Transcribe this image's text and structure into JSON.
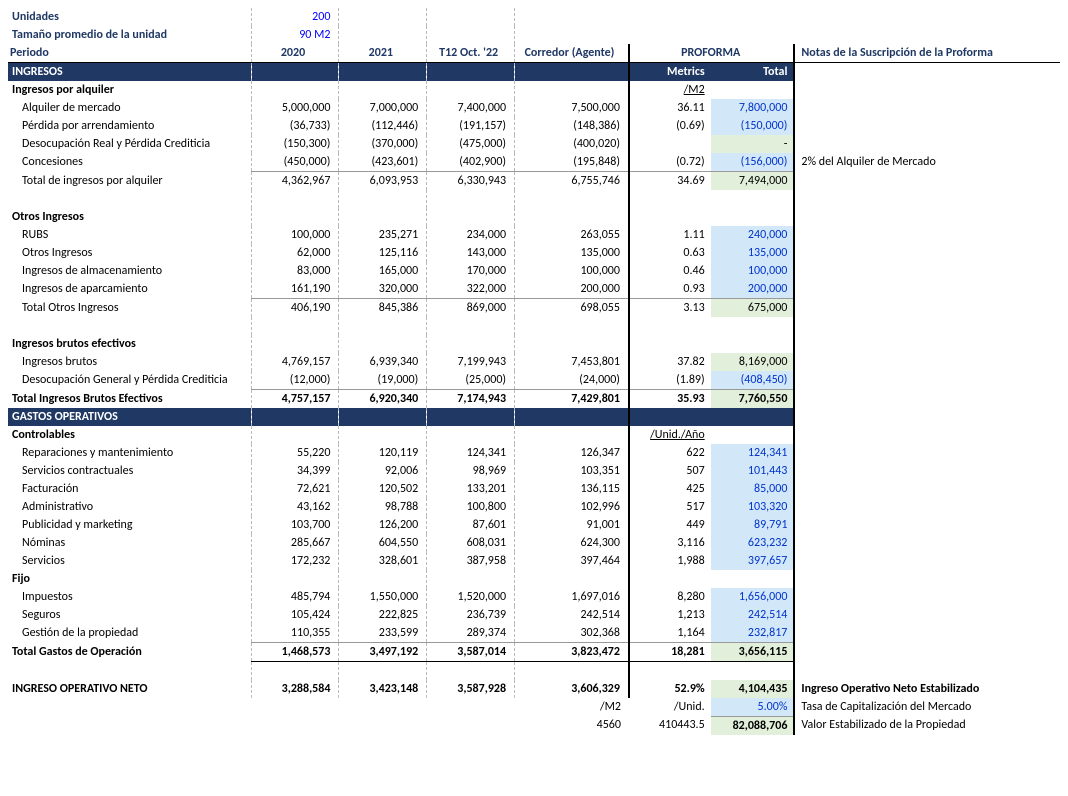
{
  "top": {
    "units_label": "Unidades",
    "units_value": "200",
    "size_label": "Tamaño promedio de la unidad",
    "size_value": "90 M2"
  },
  "cols": {
    "period": "Periodo",
    "y2020": "2020",
    "y2021": "2021",
    "t12": "T12 Oct. '22",
    "broker": "Corredor (Agente)",
    "proforma": "PROFORMA",
    "metrics": "Metrics",
    "total": "Total",
    "notes": "Notas de la Suscripción de la Proforma"
  },
  "sect": {
    "ingresos": "INGRESOS",
    "rental": "Ingresos por alquiler",
    "other": "Otros Ingresos",
    "egi_sec": "Ingresos brutos efectivos",
    "opex": "GASTOS OPERATIVOS",
    "control": "Controlables",
    "fijo": "Fijo",
    "m2": "/M2",
    "unityr": "/Unid./Año"
  },
  "rows": {
    "mkt_rent": {
      "l": "Alquiler de mercado",
      "a": "5,000,000",
      "b": "7,000,000",
      "c": "7,400,000",
      "d": "7,500,000",
      "m": "36.11",
      "t": "7,800,000"
    },
    "loss_lease": {
      "l": "Pérdida por arrendamiento",
      "a": "(36,733)",
      "b": "(112,446)",
      "c": "(191,157)",
      "d": "(148,386)",
      "m": "(0.69)",
      "t": "(150,000)"
    },
    "vac_credit": {
      "l": "Desocupación Real y Pérdida Crediticia",
      "a": "(150,300)",
      "b": "(370,000)",
      "c": "(475,000)",
      "d": "(400,020)",
      "m": "",
      "t": "-"
    },
    "concess": {
      "l": "Concesiones",
      "a": "(450,000)",
      "b": "(423,601)",
      "c": "(402,900)",
      "d": "(195,848)",
      "m": "(0.72)",
      "t": "(156,000)",
      "note": "2% del Alquiler de Mercado"
    },
    "rent_total": {
      "l": "Total de ingresos por alquiler",
      "a": "4,362,967",
      "b": "6,093,953",
      "c": "6,330,943",
      "d": "6,755,746",
      "m": "34.69",
      "t": "7,494,000"
    },
    "rubs": {
      "l": "RUBS",
      "a": "100,000",
      "b": "235,271",
      "c": "234,000",
      "d": "263,055",
      "m": "1.11",
      "t": "240,000"
    },
    "other_i": {
      "l": "Otros Ingresos",
      "a": "62,000",
      "b": "125,116",
      "c": "143,000",
      "d": "135,000",
      "m": "0.63",
      "t": "135,000"
    },
    "storage": {
      "l": "Ingresos de almacenamiento",
      "a": "83,000",
      "b": "165,000",
      "c": "170,000",
      "d": "100,000",
      "m": "0.46",
      "t": "100,000"
    },
    "parking": {
      "l": "Ingresos de aparcamiento",
      "a": "161,190",
      "b": "320,000",
      "c": "322,000",
      "d": "200,000",
      "m": "0.93",
      "t": "200,000"
    },
    "other_total": {
      "l": "Total Otros Ingresos",
      "a": "406,190",
      "b": "845,386",
      "c": "869,000",
      "d": "698,055",
      "m": "3.13",
      "t": "675,000"
    },
    "gross": {
      "l": "Ingresos brutos",
      "a": "4,769,157",
      "b": "6,939,340",
      "c": "7,199,943",
      "d": "7,453,801",
      "m": "37.82",
      "t": "8,169,000"
    },
    "gen_vac": {
      "l": "Desocupación General y Pérdida Crediticia",
      "a": "(12,000)",
      "b": "(19,000)",
      "c": "(25,000)",
      "d": "(24,000)",
      "m": "(1.89)",
      "t": "(408,450)"
    },
    "egi": {
      "l": "Total Ingresos Brutos Efectivos",
      "a": "4,757,157",
      "b": "6,920,340",
      "c": "7,174,943",
      "d": "7,429,801",
      "m": "35.93",
      "t": "7,760,550"
    },
    "repairs": {
      "l": "Reparaciones y mantenimiento",
      "a": "55,220",
      "b": "120,119",
      "c": "124,341",
      "d": "126,347",
      "m": "622",
      "t": "124,341"
    },
    "contract": {
      "l": "Servicios contractuales",
      "a": "34,399",
      "b": "92,006",
      "c": "98,969",
      "d": "103,351",
      "m": "507",
      "t": "101,443"
    },
    "billing": {
      "l": "Facturación",
      "a": "72,621",
      "b": "120,502",
      "c": "133,201",
      "d": "136,115",
      "m": "425",
      "t": "85,000"
    },
    "admin": {
      "l": "Administrativo",
      "a": "43,162",
      "b": "98,788",
      "c": "100,800",
      "d": "102,996",
      "m": "517",
      "t": "103,320"
    },
    "marketing": {
      "l": "Publicidad y marketing",
      "a": "103,700",
      "b": "126,200",
      "c": "87,601",
      "d": "91,001",
      "m": "449",
      "t": "89,791"
    },
    "payroll": {
      "l": "Nóminas",
      "a": "285,667",
      "b": "604,550",
      "c": "608,031",
      "d": "624,300",
      "m": "3,116",
      "t": "623,232"
    },
    "services": {
      "l": "Servicios",
      "a": "172,232",
      "b": "328,601",
      "c": "387,958",
      "d": "397,464",
      "m": "1,988",
      "t": "397,657"
    },
    "taxes": {
      "l": "Impuestos",
      "a": "485,794",
      "b": "1,550,000",
      "c": "1,520,000",
      "d": "1,697,016",
      "m": "8,280",
      "t": "1,656,000"
    },
    "insurance": {
      "l": "Seguros",
      "a": "105,424",
      "b": "222,825",
      "c": "236,739",
      "d": "242,514",
      "m": "1,213",
      "t": "242,514"
    },
    "propmgmt": {
      "l": "Gestión de la propiedad",
      "a": "110,355",
      "b": "233,599",
      "c": "289,374",
      "d": "302,368",
      "m": "1,164",
      "t": "232,817"
    },
    "opex_total": {
      "l": "Total Gastos de Operación",
      "a": "1,468,573",
      "b": "3,497,192",
      "c": "3,587,014",
      "d": "3,823,472",
      "m": "18,281",
      "t": "3,656,115"
    },
    "noi": {
      "l": "INGRESO OPERATIVO NETO",
      "a": "3,288,584",
      "b": "3,423,148",
      "c": "3,587,928",
      "d": "3,606,329",
      "m": "52.9%",
      "t": "4,104,435",
      "note": "Ingreso Operativo Neto Estabilizado"
    }
  },
  "footer": {
    "m2": "/M2",
    "unid": "/Unid.",
    "cap_rate": "5.00%",
    "cap_note": "Tasa de Capitalización del Mercado",
    "v1": "4560",
    "v2": "410443.5",
    "val": "82,088,706",
    "val_note": "Valor Estabilizado de la Propiedad"
  }
}
